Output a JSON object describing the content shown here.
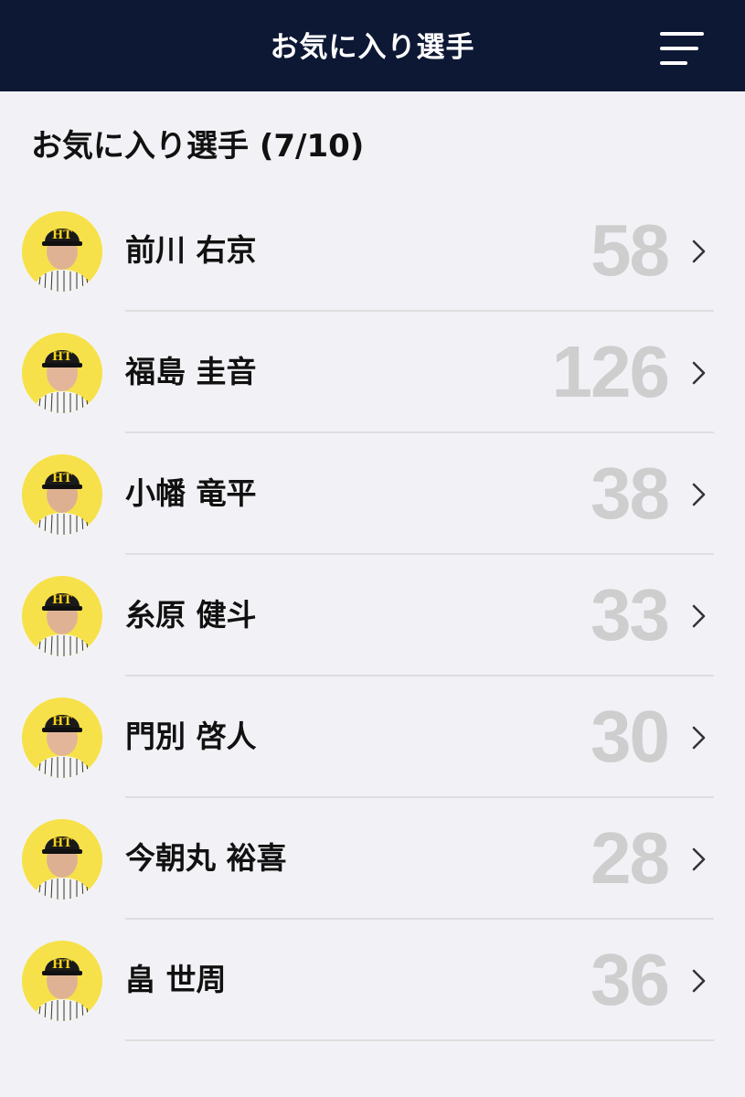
{
  "header": {
    "title": "お気に入り選手",
    "menu_icon": "hamburger-menu-icon"
  },
  "section": {
    "title": "お気に入り選手 (7/10)"
  },
  "players": [
    {
      "name": "前川 右京",
      "number": "58",
      "chevron_icon": "chevron-right-icon",
      "avatar_bg": "#f7e14a"
    },
    {
      "name": "福島 圭音",
      "number": "126",
      "chevron_icon": "chevron-right-icon",
      "avatar_bg": "#f7e14a"
    },
    {
      "name": "小幡 竜平",
      "number": "38",
      "chevron_icon": "chevron-right-icon",
      "avatar_bg": "#f7e14a"
    },
    {
      "name": "糸原 健斗",
      "number": "33",
      "chevron_icon": "chevron-right-icon",
      "avatar_bg": "#f7e14a"
    },
    {
      "name": "門別 啓人",
      "number": "30",
      "chevron_icon": "chevron-right-icon",
      "avatar_bg": "#f7e14a"
    },
    {
      "name": "今朝丸 裕喜",
      "number": "28",
      "chevron_icon": "chevron-right-icon",
      "avatar_bg": "#f7e14a"
    },
    {
      "name": "畠 世周",
      "number": "36",
      "chevron_icon": "chevron-right-icon",
      "avatar_bg": "#f7e14a"
    }
  ],
  "colors": {
    "header_bg": "#0d1834",
    "page_bg": "#f2f2f6",
    "number_gray": "#cecece",
    "divider": "#dedede"
  }
}
